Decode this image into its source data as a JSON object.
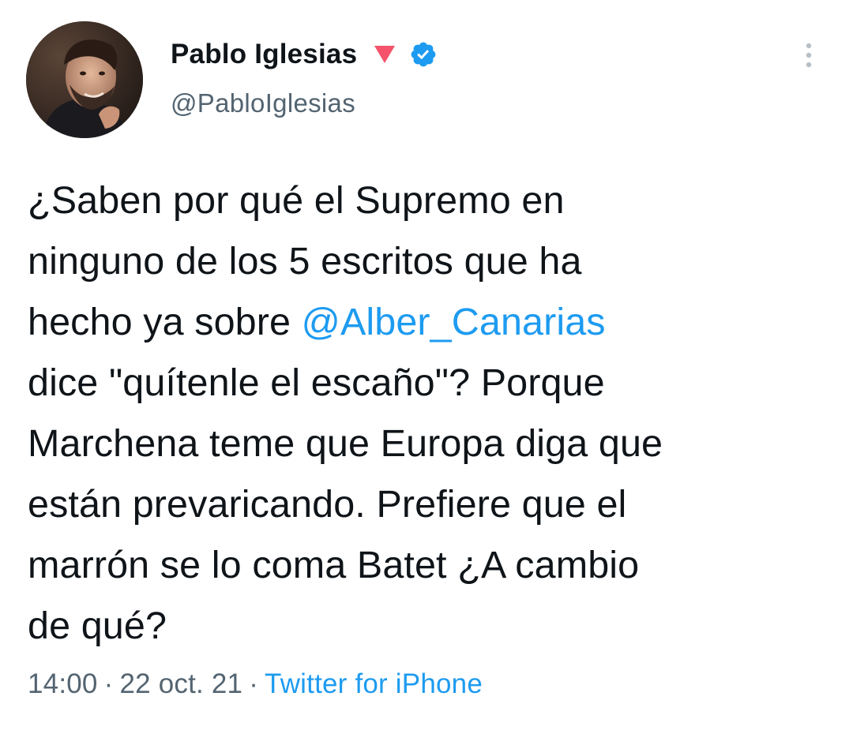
{
  "author": {
    "display_name": "Pablo Iglesias",
    "handle": "@PabloIglesias",
    "name_emoji": "red-triangle-down-icon",
    "verified_icon": "verified-badge-icon"
  },
  "tweet": {
    "lines": [
      {
        "before": "¿Saben por qué el Supremo en"
      },
      {
        "before": "ninguno de los 5 escritos que ha"
      },
      {
        "before": "hecho ya sobre ",
        "mention": "@Alber_Canarias"
      },
      {
        "before": "dice \"quítenle el escaño\"? Porque"
      },
      {
        "before": "Marchena teme que Europa diga que"
      },
      {
        "before": "están prevaricando. Prefiere que el"
      },
      {
        "before": "marrón se lo coma Batet ¿A cambio"
      },
      {
        "before": "de qué?"
      }
    ]
  },
  "meta": {
    "time": "14:00",
    "separator": "·",
    "date": "22 oct. 21",
    "source": "Twitter for iPhone"
  },
  "colors": {
    "link": "#1d9bf0",
    "secondary_text": "#536471",
    "primary_text": "#0f1419",
    "triangle": "#f4536b"
  },
  "icons": {
    "more": "more-vertical-icon"
  }
}
